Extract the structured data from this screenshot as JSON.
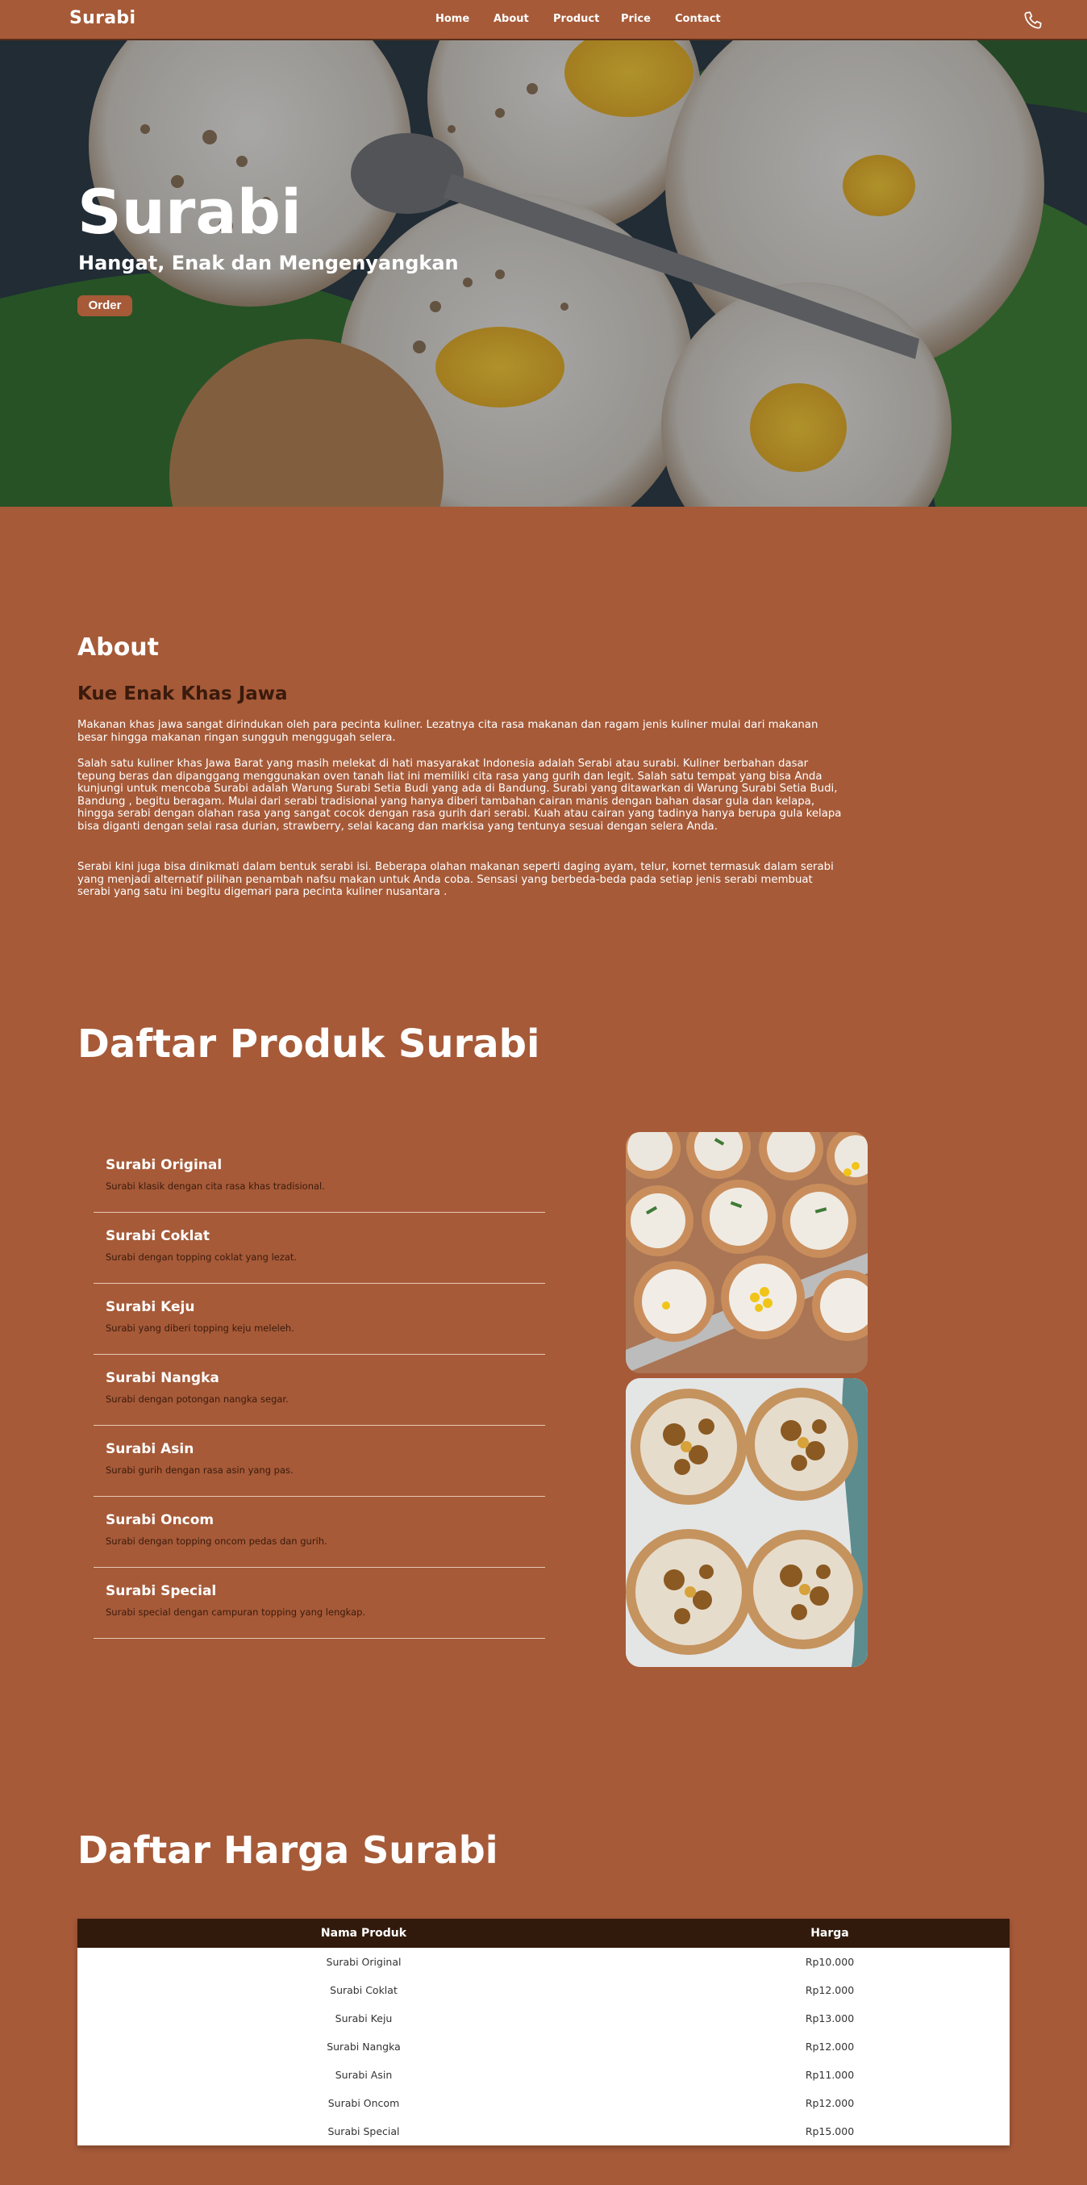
{
  "brand": "Surabi",
  "nav": {
    "links": [
      "Home",
      "About",
      "Product",
      "Price",
      "Contact"
    ],
    "phone_icon": "phone-icon"
  },
  "hero": {
    "title": "Surabi",
    "subtitle": "Hangat, Enak dan Mengenyangkan",
    "order_button": "Order"
  },
  "about": {
    "heading": "About",
    "subheading": "Kue Enak Khas Jawa",
    "paragraphs": [
      "Makanan khas jawa sangat dirindukan oleh para pecinta kuliner. Lezatnya cita rasa makanan dan ragam jenis kuliner mulai dari makanan besar hingga makanan ringan sungguh menggugah selera.",
      "Salah satu kuliner khas Jawa Barat yang masih melekat di hati masyarakat Indonesia adalah Serabi atau surabi. Kuliner berbahan dasar tepung beras dan dipanggang menggunakan oven tanah liat ini memiliki cita rasa yang gurih dan legit. Salah satu tempat yang bisa Anda kunjungi untuk mencoba Surabi adalah Warung Surabi Setia Budi yang ada di Bandung. Surabi yang ditawarkan di Warung Surabi Setia Budi, Bandung , begitu beragam. Mulai dari serabi tradisional yang hanya diberi tambahan cairan manis dengan bahan dasar gula dan kelapa, hingga serabi dengan olahan rasa yang sangat cocok dengan rasa gurih dari serabi. Kuah atau cairan yang tadinya hanya berupa gula kelapa bisa diganti dengan selai rasa durian, strawberry, selai kacang dan markisa yang tentunya sesuai dengan selera Anda.",
      "Serabi kini juga bisa dinikmati dalam bentuk serabi isi. Beberapa olahan makanan seperti daging ayam, telur, kornet termasuk dalam serabi yang menjadi alternatif pilihan penambah nafsu makan untuk Anda coba. Sensasi yang berbeda-beda pada setiap jenis serabi membuat serabi yang satu ini begitu digemari para pecinta kuliner nusantara ."
    ]
  },
  "products": {
    "heading": "Daftar Produk Surabi",
    "items": [
      {
        "name": "Surabi Original",
        "desc": "Surabi klasik dengan cita rasa khas tradisional."
      },
      {
        "name": "Surabi Coklat",
        "desc": "Surabi dengan topping coklat yang lezat."
      },
      {
        "name": "Surabi Keju",
        "desc": "Surabi yang diberi topping keju meleleh."
      },
      {
        "name": "Surabi Nangka",
        "desc": "Surabi dengan potongan nangka segar."
      },
      {
        "name": "Surabi Asin",
        "desc": "Surabi gurih dengan rasa asin yang pas."
      },
      {
        "name": "Surabi Oncom",
        "desc": "Surabi dengan topping oncom pedas dan gurih."
      },
      {
        "name": "Surabi Special",
        "desc": "Surabi special dengan campuran topping yang lengkap."
      }
    ]
  },
  "price": {
    "heading": "Daftar Harga Surabi",
    "columns": [
      "Nama Produk",
      "Harga"
    ],
    "rows": [
      [
        "Surabi Original",
        "Rp10.000"
      ],
      [
        "Surabi Coklat",
        "Rp12.000"
      ],
      [
        "Surabi Keju",
        "Rp13.000"
      ],
      [
        "Surabi Nangka",
        "Rp12.000"
      ],
      [
        "Surabi Asin",
        "Rp11.000"
      ],
      [
        "Surabi Oncom",
        "Rp12.000"
      ],
      [
        "Surabi Special",
        "Rp15.000"
      ]
    ]
  },
  "colors": {
    "background": "#a65a38",
    "dark_brown": "#311a0c",
    "accent_text": "#3a1a0c"
  }
}
